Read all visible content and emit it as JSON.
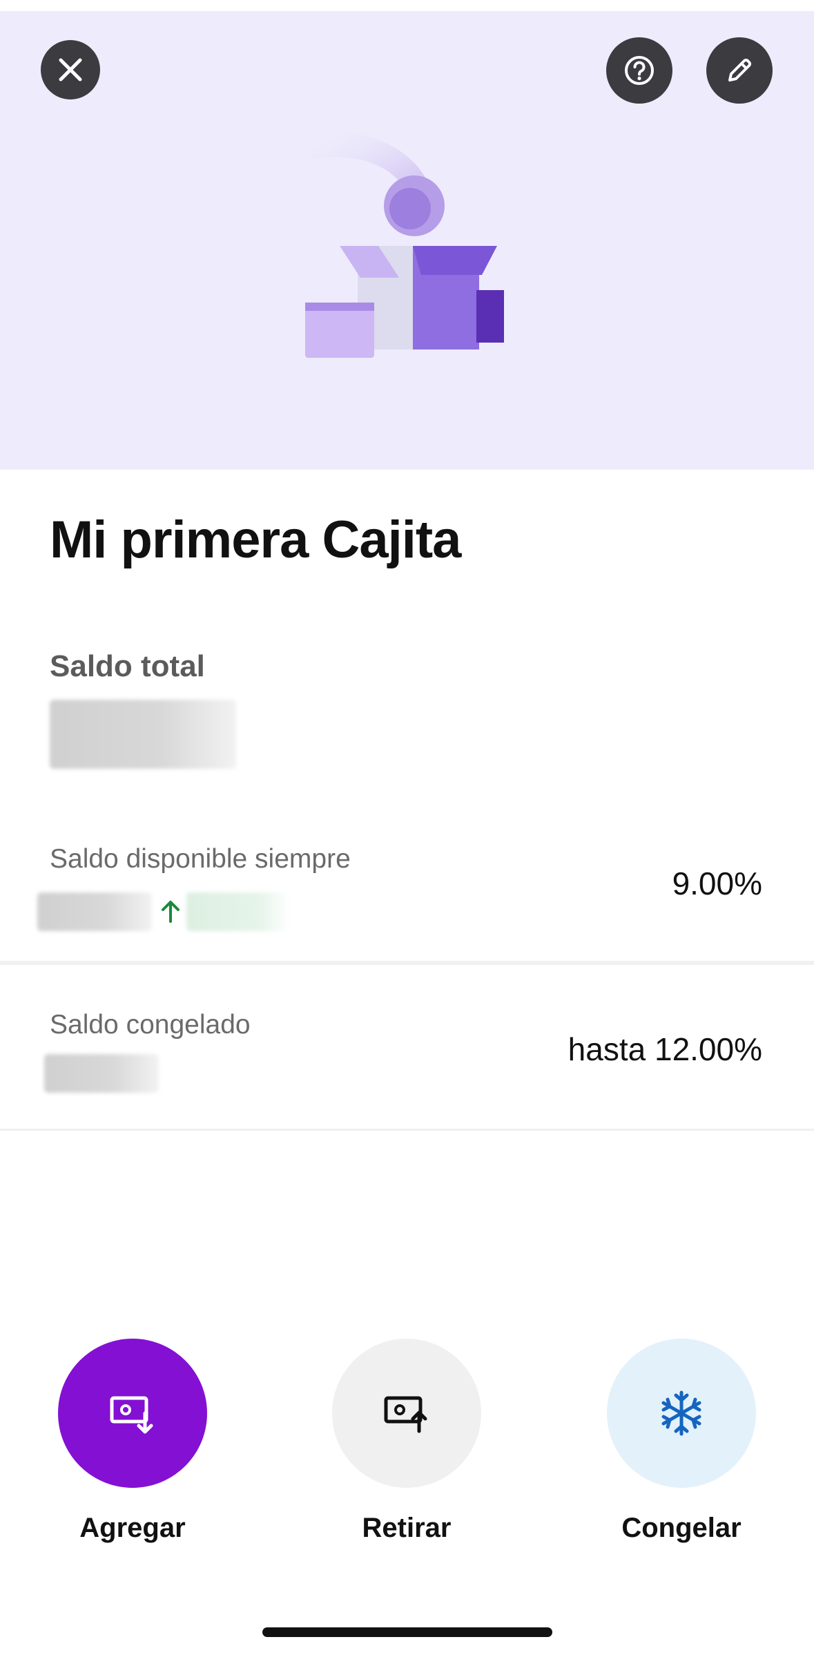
{
  "header": {
    "close_icon": "close-icon",
    "help_icon": "help-icon",
    "edit_icon": "pencil-icon"
  },
  "title": "Mi primera Cajita",
  "balance": {
    "total_label": "Saldo total"
  },
  "available": {
    "label": "Saldo disponible siempre",
    "rate": "9.00%",
    "trend_icon": "arrow-up-icon"
  },
  "frozen": {
    "label": "Saldo congelado",
    "rate": "hasta 12.00%"
  },
  "actions": [
    {
      "label": "Agregar",
      "icon": "deposit-icon",
      "color": "#8410d4"
    },
    {
      "label": "Retirar",
      "icon": "withdraw-icon",
      "color": "#f0f0f0"
    },
    {
      "label": "Congelar",
      "icon": "snowflake-icon",
      "color": "#e3f1fb"
    }
  ],
  "colors": {
    "hero_bg": "#eeecfc",
    "accent_purple": "#8410d4",
    "trend_green": "#1a8a3a",
    "snowflake_blue": "#1565c0"
  }
}
